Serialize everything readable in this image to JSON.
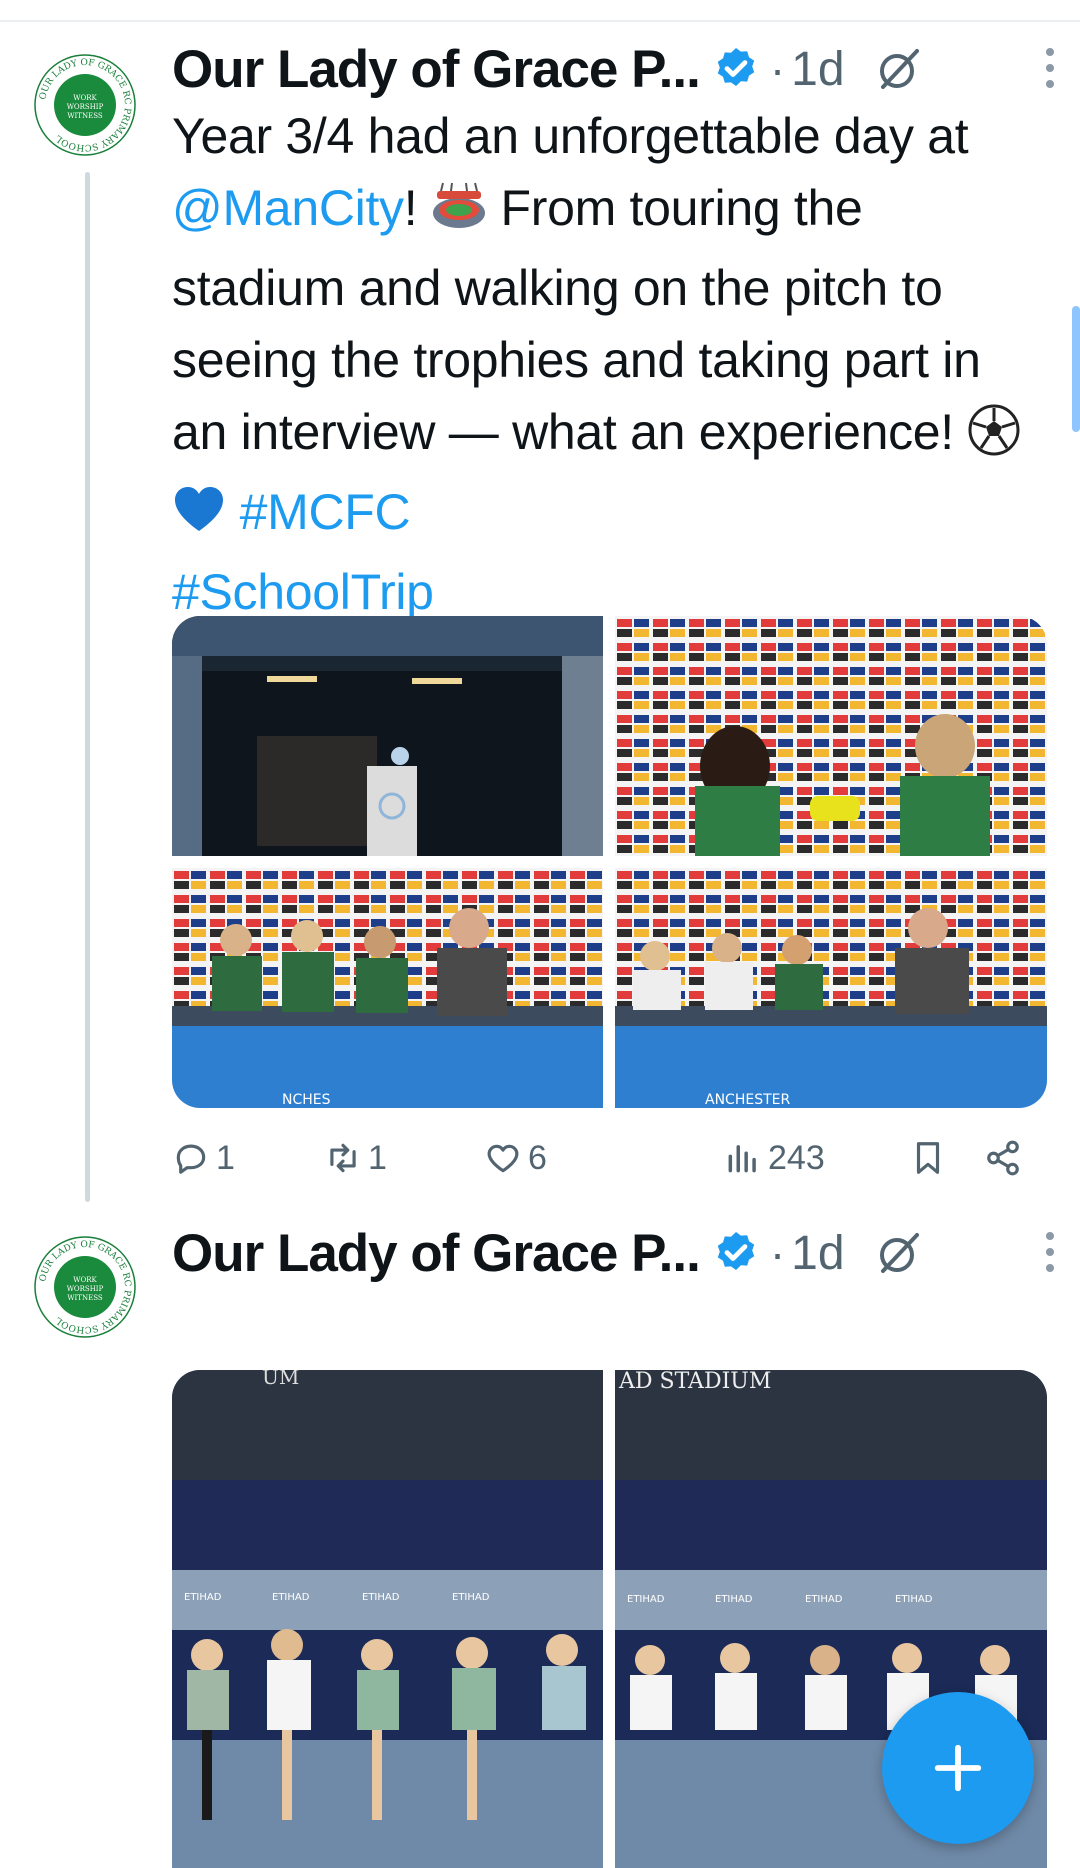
{
  "tweets": [
    {
      "author": "Our Lady of Grace P...",
      "time": "1d",
      "text": {
        "p1": "Year 3/4 had an unforgettable day at ",
        "mention": "@ManCity",
        "p2": "! ",
        "p3": " From touring the stadium and walking on the pitch to seeing the trophies and taking part in an interview — what an experience! ",
        "tag1": "#MCFC",
        "tag2": "#SchoolTrip"
      },
      "stats": {
        "replies": "1",
        "reposts": "1",
        "likes": "6",
        "views": "243"
      }
    },
    {
      "author": "Our Lady of Grace P...",
      "time": "1d"
    }
  ],
  "avatar_logo": {
    "ring_text": "OUR LADY OF GRACE RC PRIMARY SCHOOL",
    "center_text": [
      "WORK",
      "WORSHIP",
      "WITNESS"
    ]
  },
  "photo_signage": {
    "photo5_top": "UM",
    "photo6_top": "AD STADIUM",
    "board": "ETIHAD",
    "desk": "NCHES",
    "desk2": "ANCHESTER"
  },
  "colors": {
    "accent": "#1d9bf0",
    "muted": "#536471",
    "text": "#0f1419"
  },
  "icons": [
    "verified-badge-icon",
    "grok-icon",
    "more-icon",
    "reply-icon",
    "repost-icon",
    "like-icon",
    "views-icon",
    "bookmark-icon",
    "share-icon",
    "plus-icon"
  ]
}
